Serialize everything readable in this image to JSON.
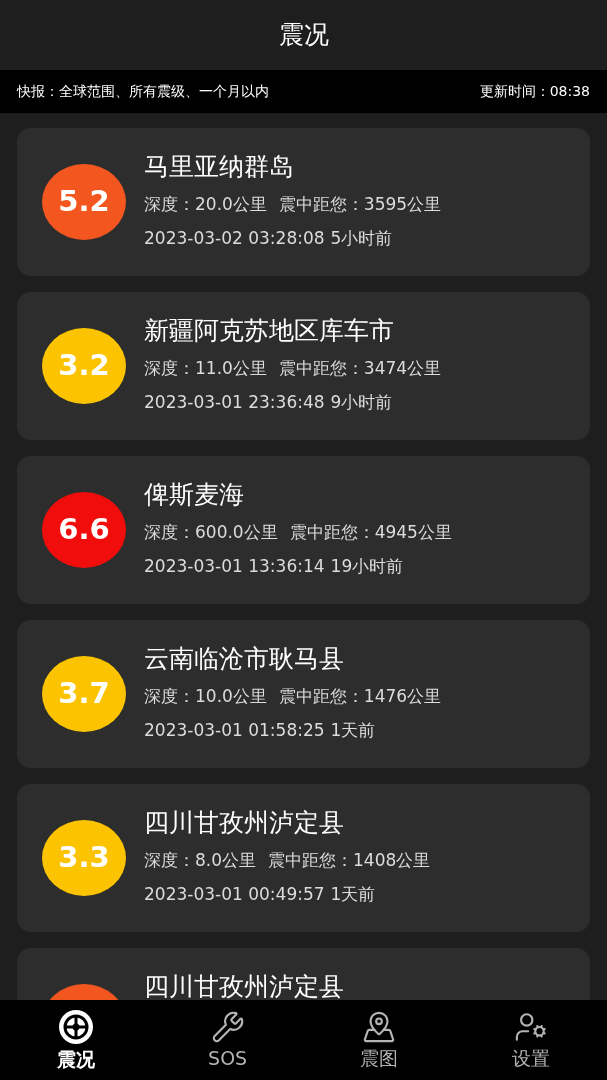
{
  "header": {
    "title": "震况"
  },
  "ticker": {
    "summary": "快报：全球范围、所有震级、一个月以内",
    "updated": "更新时间：08:38"
  },
  "quakes": [
    {
      "magnitude": "5.2",
      "color": "#f4561f",
      "place": "马里亚纳群岛",
      "depth": "深度：20.0公里",
      "distance": "震中距您：3595公里",
      "time": "2023-03-02 03:28:08",
      "ago": "5小时前"
    },
    {
      "magnitude": "3.2",
      "color": "#fcc400",
      "place": "新疆阿克苏地区库车市",
      "depth": "深度：11.0公里",
      "distance": "震中距您：3474公里",
      "time": "2023-03-01 23:36:48",
      "ago": "9小时前"
    },
    {
      "magnitude": "6.6",
      "color": "#f20d0d",
      "place": "俾斯麦海",
      "depth": "深度：600.0公里",
      "distance": "震中距您：4945公里",
      "time": "2023-03-01 13:36:14",
      "ago": "19小时前"
    },
    {
      "magnitude": "3.7",
      "color": "#fcc400",
      "place": "云南临沧市耿马县",
      "depth": "深度：10.0公里",
      "distance": "震中距您：1476公里",
      "time": "2023-03-01 01:58:25",
      "ago": "1天前"
    },
    {
      "magnitude": "3.3",
      "color": "#fcc400",
      "place": "四川甘孜州泸定县",
      "depth": "深度：8.0公里",
      "distance": "震中距您：1408公里",
      "time": "2023-03-01 00:49:57",
      "ago": "1天前"
    },
    {
      "color": "#f4561f",
      "place": "四川甘孜州泸定县"
    }
  ],
  "nav": [
    {
      "kind": "wheel",
      "label": "震况",
      "selected": true
    },
    {
      "kind": "wrench",
      "label": "SOS",
      "selected": false
    },
    {
      "kind": "map",
      "label": "震图",
      "selected": false
    },
    {
      "kind": "settings",
      "label": "设置",
      "selected": false
    }
  ]
}
